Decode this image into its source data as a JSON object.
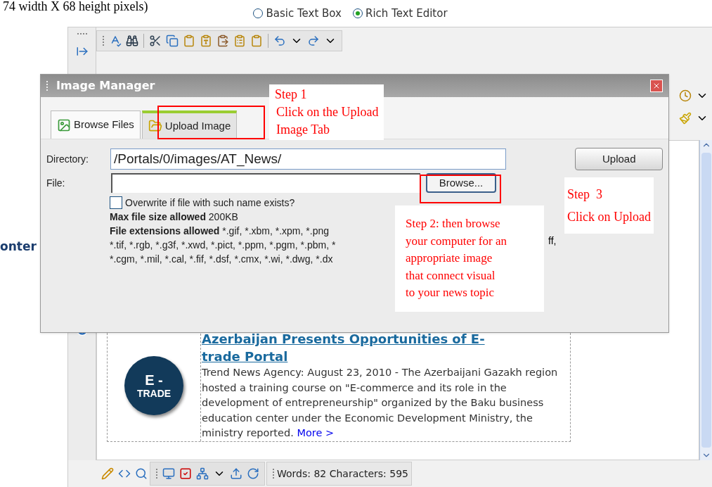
{
  "caption": "74 width X 68 height pixels)",
  "editor_mode": [
    {
      "label": "Basic Text Box",
      "selected": false
    },
    {
      "label": "Rich Text Editor",
      "selected": true
    }
  ],
  "page_label": "onter",
  "dialog": {
    "title": "Image Manager",
    "tabs": [
      {
        "label": "Browse Files",
        "selected": false
      },
      {
        "label": "Upload Image",
        "selected": true
      }
    ],
    "directory_label": "Directory:",
    "directory_value": "/Portals/0/images/AT_News/",
    "file_label": "File:",
    "browse_button": "Browse...",
    "upload_button": "Upload",
    "overwrite": {
      "label": "Overwrite if file with such name exists?",
      "checked": false
    },
    "max_size": "**Max file size allowed** 200KB",
    "extension_lines": [
      "**File extensions allowed** *.gif, *.xbm, *.xpm, *.png",
      "*.tif, *.rgb, *.g3f, *.xwd, *.pict, *.ppm, *.pgm, *.pbm, *",
      "*.cgm, *.mil, *.cal, *.fif, *.dsf, *.cmx, *.wi, *.dwg, *.dx"
    ],
    "extension_tail": "ff,"
  },
  "callouts": [
    {
      "lines": [
        "Step 1",
        "Click on the Upload",
        "Image Tab"
      ]
    },
    {
      "lines": [
        "Step 2: then browse",
        "your computer for an",
        "appropriate image",
        "that connect visual",
        "to your news topic"
      ]
    },
    {
      "lines": [
        "Step  3",
        "Click on Upload"
      ]
    }
  ],
  "article": {
    "logo_lines": [
      "E -",
      "TRADE"
    ],
    "headline": "Azerbaijan Presents Opportunities of E-trade Portal",
    "body": "Trend News Agency: August 23, 2010 - The Azerbaijani Gazakh region hosted a training course on \"E-commerce and its role in the development of entrepreneurship\" organized by the Baku business education center under the Economic Development Ministry, the ministry reported.",
    "more_link": "More >"
  },
  "status": "Words: 82 Characters: 595"
}
